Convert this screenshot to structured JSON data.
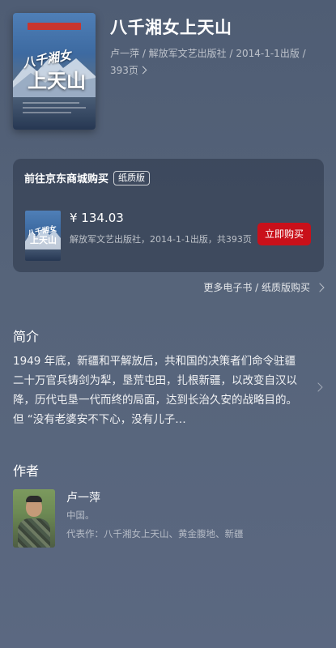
{
  "book": {
    "title": "八千湘女上天山",
    "meta": "卢一萍 / 解放军文艺出版社 / 2014-1-1出版 / 393页",
    "cover_title_line1": "八千湘女",
    "cover_title_line2": "上天山"
  },
  "jd": {
    "header": "前往京东商城购买",
    "badge": "纸质版",
    "price": "¥ 134.03",
    "description": "解放军文艺出版社，2014-1-1出版，共393页",
    "buy_label": "立即购买"
  },
  "more_link": "更多电子书 / 纸质版购买",
  "intro": {
    "title": "简介",
    "text": "1949 年底，新疆和平解放后，共和国的决策者们命令驻疆二十万官兵铸剑为犁，垦荒屯田，扎根新疆，以改变自汉以降，历代屯垦一代而终的局面，达到长治久安的战略目的。但 “没有老婆安不下心，没有儿子…"
  },
  "author": {
    "title": "作者",
    "name": "卢一萍",
    "origin": "中国。",
    "works": "代表作：八千湘女上天山、黄金腹地、新疆"
  },
  "colors": {
    "background": "#56647a",
    "buy_button": "#c9101a"
  },
  "icons": [
    "chevron-right-icon"
  ]
}
